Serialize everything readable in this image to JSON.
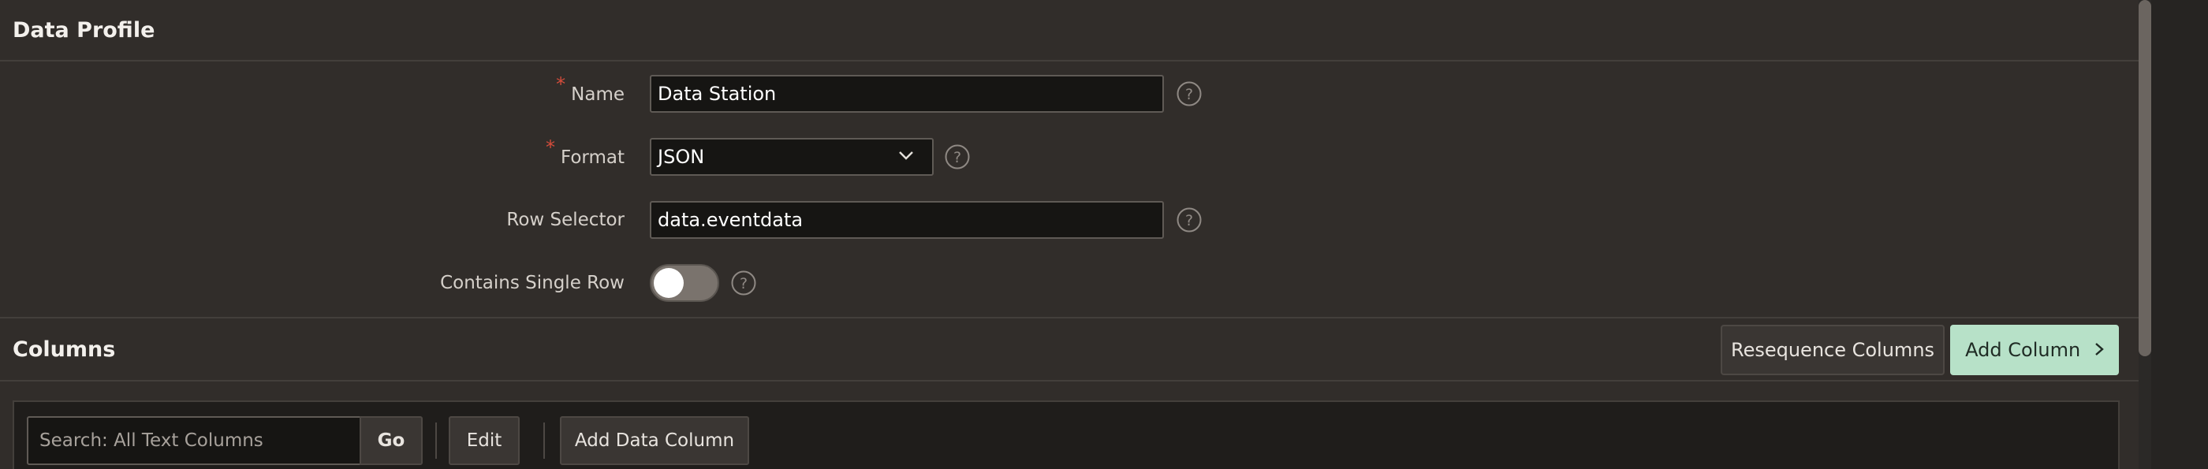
{
  "profile": {
    "title": "Data Profile",
    "required_mark": "*",
    "name_label": "Name",
    "name_value": "Data Station",
    "format_label": "Format",
    "format_value": "JSON",
    "row_selector_label": "Row Selector",
    "row_selector_value": "data.eventdata",
    "single_row_label": "Contains Single Row",
    "single_row_on": false,
    "help_icon_glyph": "?"
  },
  "columns": {
    "title": "Columns",
    "resequence_label": "Resequence Columns",
    "add_column_label": "Add Column"
  },
  "toolbar": {
    "search_placeholder": "Search: All Text Columns",
    "go_label": "Go",
    "edit_label": "Edit",
    "add_data_column_label": "Add Data Column"
  },
  "icons": {
    "help": "help-circle-icon",
    "chevron": "chevron-down-icon",
    "next": "chevron-right-icon"
  },
  "colors": {
    "required": "#d44c3b",
    "primary_button": "#b7e1c8"
  }
}
